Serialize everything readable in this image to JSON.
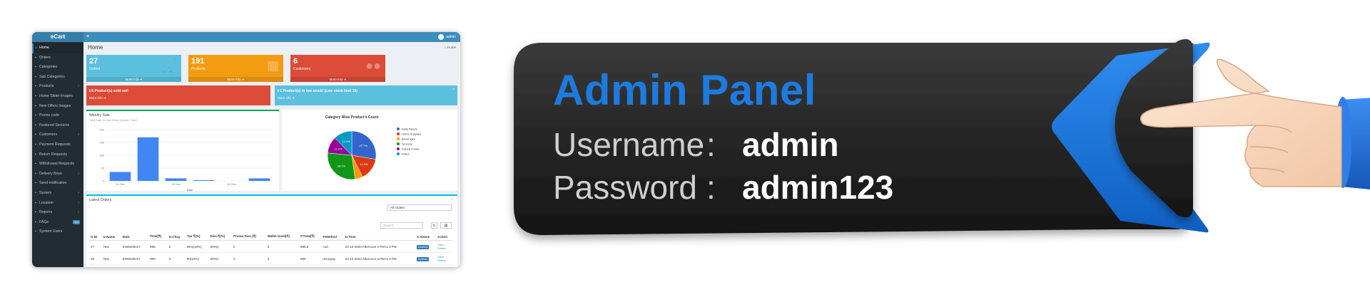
{
  "card": {
    "title": "Admin Panel",
    "username_label": "Username",
    "username_value": "admin",
    "password_label": "Password",
    "password_value": "admin123",
    "colon": ":",
    "accent": "#1d7be0",
    "card_color": "#2b2b2b"
  },
  "app": {
    "brand": "eCart",
    "user": "admin",
    "page_title": "Home",
    "breadcrumb": "Home",
    "sidebar": [
      {
        "label": "Home",
        "icon": "home-icon"
      },
      {
        "label": "Orders",
        "icon": "cart-icon"
      },
      {
        "label": "Categories",
        "icon": "list-icon"
      },
      {
        "label": "Sub Categories",
        "icon": "list-icon"
      },
      {
        "label": "Products",
        "icon": "box-icon",
        "caret": "‹"
      },
      {
        "label": "Home Slider Images",
        "icon": "image-icon"
      },
      {
        "label": "New Offers Images",
        "icon": "image-icon"
      },
      {
        "label": "Promo code",
        "icon": "tag-icon"
      },
      {
        "label": "Featured Sections",
        "icon": "star-icon"
      },
      {
        "label": "Customers",
        "icon": "user-icon",
        "caret": "‹"
      },
      {
        "label": "Payment Requests",
        "icon": "money-icon"
      },
      {
        "label": "Return Requests",
        "icon": "return-icon"
      },
      {
        "label": "Withdrawal Requests",
        "icon": "money-icon"
      },
      {
        "label": "Delivery Boys",
        "icon": "truck-icon",
        "caret": "‹"
      },
      {
        "label": "Send notification",
        "icon": "bell-icon"
      },
      {
        "label": "System",
        "icon": "gear-icon",
        "caret": "‹"
      },
      {
        "label": "Location",
        "icon": "pin-icon",
        "caret": "‹"
      },
      {
        "label": "Reports",
        "icon": "chart-icon",
        "caret": "‹"
      },
      {
        "label": "FAQs",
        "icon": "question-icon",
        "badge": "new"
      },
      {
        "label": "System Users",
        "icon": "users-icon"
      }
    ],
    "stats": [
      {
        "value": "27",
        "label": "Orders",
        "more": "More info",
        "color": "#5bc0de",
        "icon": "cart-icon"
      },
      {
        "value": "191",
        "label": "Products",
        "more": "More info",
        "color": "#f39c12",
        "icon": "cubes-icon"
      },
      {
        "value": "6",
        "label": "Customers",
        "more": "More info",
        "color": "#dd4b39",
        "icon": "users-icon"
      }
    ],
    "alerts": [
      {
        "title": "6 Product(s) sold out!",
        "more": "More info",
        "color": "#dd4b39"
      },
      {
        "title": "1 Product(s) in low stock! (Low stock limit 10)",
        "more": "More info",
        "color": "#5bc0de"
      }
    ],
    "weekly": {
      "title": "Weekly Sale",
      "subtitle": "Total Sale In Last Week (Month: Year)",
      "xlabel": "Date"
    },
    "pie_title": "Category Wise Product's Count",
    "orders_panel": {
      "title": "Latest Orders",
      "filter": "All Orders",
      "search_placeholder": "Search",
      "columns": [
        "O.ID",
        "U.Name",
        "Mob.",
        "Total(₹)",
        "D.Chrg",
        "Tax ₹(%)",
        "Disc.₹(%)",
        "Promo Disc.(₹)",
        "Wallet Used(₹)",
        "F.Total(₹)",
        "P.Method",
        "D.Time",
        "A.Status",
        "Action"
      ],
      "rows": [
        [
          "27",
          "Test",
          "9409406107",
          "896",
          "0",
          "89.6(10%)",
          "0(0%)",
          "0",
          "0",
          "985.6",
          "cod",
          "23-12-2020 Afternoon 3 PM to 3 PM",
          "received",
          "View"
        ],
        [
          "26",
          "Test",
          "9409406107",
          "800",
          "0",
          "80(10%)",
          "0(0%)",
          "0",
          "0",
          "880",
          "razorpay",
          "23-12-2020 Afternoon 3 PM to 3 PM",
          "received",
          "View"
        ]
      ],
      "row_action_extra": "Delete"
    }
  },
  "chart_data": [
    {
      "type": "bar",
      "title": "Weekly Sale",
      "categories": [
        "21-Dec",
        "",
        "19-Dec",
        "",
        "18-Dec",
        ""
      ],
      "values": [
        35,
        170,
        10,
        3,
        0,
        10
      ],
      "ylim": [
        0,
        200
      ],
      "yticks": [
        "0",
        "50",
        "100",
        "150",
        "200"
      ],
      "xlabel": "Date",
      "color": "#4285f4"
    },
    {
      "type": "pie",
      "title": "Category Wise Product's Count",
      "labels": [
        "Daily Needs",
        "Home Supplies",
        "Beverages",
        "Grocery",
        "Instant Foods",
        "Dates"
      ],
      "values": [
        27.7,
        14.9,
        5.2,
        28.7,
        11.2,
        12.3
      ],
      "slice_labels": [
        "27.7%",
        "14.9%",
        "",
        "28.7%",
        "11.2%",
        "12.3%"
      ],
      "colors": [
        "#3366cc",
        "#dc3912",
        "#ff9900",
        "#109618",
        "#990099",
        "#0099c6"
      ]
    }
  ]
}
